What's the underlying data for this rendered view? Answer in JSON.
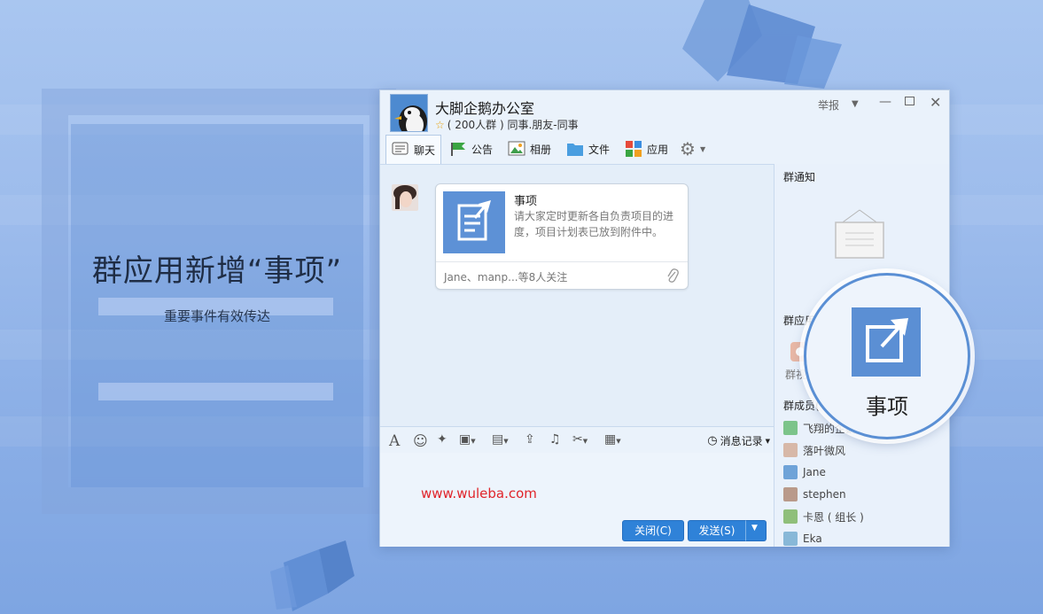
{
  "hero": {
    "title": "群应用新增“事项”",
    "subtitle": "重要事件有效传达"
  },
  "window": {
    "group_name": "大脚企鹅办公室",
    "group_meta": "( 200人群 ) 同事.朋友-同事",
    "report_label": "举报",
    "tabs": [
      {
        "label": "聊天",
        "icon": "chat-icon"
      },
      {
        "label": "公告",
        "icon": "announcement-icon"
      },
      {
        "label": "相册",
        "icon": "album-icon"
      },
      {
        "label": "文件",
        "icon": "folder-icon"
      },
      {
        "label": "应用",
        "icon": "apps-icon"
      }
    ],
    "settings_icon": "gear-icon"
  },
  "chat": {
    "card": {
      "title": "事项",
      "description": "请大家定时更新各自负责项目的进度，项目计划表已放到附件中。",
      "footer": "Jane、manp...等8人关注"
    }
  },
  "input": {
    "history_label": "消息记录",
    "watermark": "www.wuleba.com",
    "close_label": "关闭(C)",
    "send_label": "发送(S)"
  },
  "sidebar": {
    "notice_title": "群通知",
    "apps_title": "群应用",
    "app_label": "群视",
    "members_title": "群成员(",
    "members": [
      {
        "name": "飞翔的企鹅",
        "color": "#7cc48a"
      },
      {
        "name": "落叶微风",
        "color": "#d7b8a8"
      },
      {
        "name": "Jane",
        "color": "#6fa3d8"
      },
      {
        "name": "stephen",
        "color": "#b99a8a"
      },
      {
        "name": "卡恩 ( 组长 )",
        "color": "#8fbf7a"
      },
      {
        "name": "Eka",
        "color": "#88b8d8"
      }
    ]
  },
  "badge": {
    "label": "事项"
  },
  "colors": {
    "accent": "#2f82d8",
    "icon_blue": "#5b8fd4",
    "watermark_red": "#e0242a"
  }
}
